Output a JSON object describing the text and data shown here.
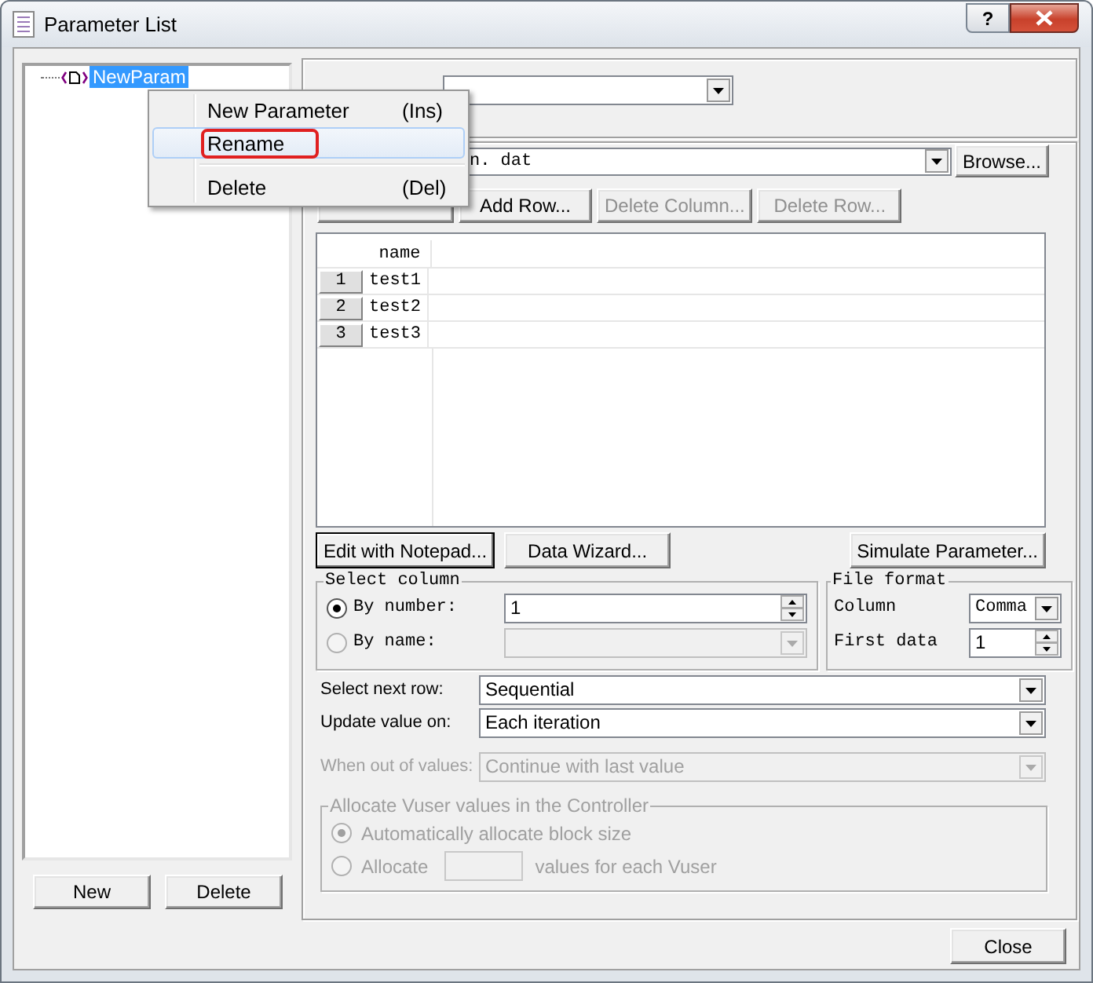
{
  "window": {
    "title": "Parameter List",
    "help": "?"
  },
  "tree": {
    "items": [
      {
        "label": "NewParam",
        "selected": true
      }
    ]
  },
  "context_menu": {
    "items": [
      {
        "kind": "item",
        "label": "New Parameter",
        "shortcut": "(Ins)",
        "selected": false,
        "outlined": false
      },
      {
        "kind": "item",
        "label": "Rename",
        "selected": true,
        "outlined": true
      },
      {
        "kind": "separator"
      },
      {
        "kind": "item",
        "label": "Delete",
        "shortcut": "(Del)",
        "selected": false,
        "outlined": false
      }
    ]
  },
  "left_buttons": [
    "New",
    "Delete"
  ],
  "file_path": {
    "value": "n. dat",
    "browse": "Browse..."
  },
  "table_buttons": [
    {
      "label": "Add Row...",
      "disabled": false
    },
    {
      "label": "Delete Column...",
      "disabled": true
    },
    {
      "label": "Delete Row...",
      "disabled": true
    }
  ],
  "table": {
    "columns": [
      "name"
    ],
    "rows": [
      {
        "number": "1",
        "cells": [
          "test1"
        ]
      },
      {
        "number": "2",
        "cells": [
          "test2"
        ]
      },
      {
        "number": "3",
        "cells": [
          "test3"
        ]
      }
    ]
  },
  "action_buttons": [
    {
      "label": "Edit with Notepad...",
      "default": true
    },
    {
      "label": "Data Wizard...",
      "default": false
    },
    {
      "label": "Simulate Parameter...",
      "default": false
    }
  ],
  "select_column": {
    "title": "Select column",
    "options": [
      {
        "kind": "spin",
        "label": "By number:",
        "value": "1",
        "selected": true,
        "disabled": false
      },
      {
        "kind": "combo",
        "label": "By name:",
        "selected": false,
        "disabled": true
      }
    ]
  },
  "file_format": {
    "title": "File format",
    "fields": [
      {
        "kind": "combo",
        "label": "Column",
        "value": "Comma"
      },
      {
        "kind": "spin",
        "label": "First data",
        "value": "1"
      }
    ]
  },
  "settings": [
    {
      "label": "Select next row:",
      "value": "Sequential",
      "disabled": false
    },
    {
      "label": "Update value on:",
      "value": "Each iteration",
      "disabled": false
    },
    {
      "label": "When out of values:",
      "value": "Continue with last value",
      "disabled": true
    }
  ],
  "allocate": {
    "title": "Allocate Vuser values in the Controller",
    "disabled": true,
    "options": [
      {
        "kind": "radio",
        "label": "Automatically allocate block size",
        "selected": true
      },
      {
        "kind": "field",
        "label": "Allocate",
        "suffix": "values for each Vuser",
        "selected": false
      }
    ]
  },
  "close_button": "Close"
}
